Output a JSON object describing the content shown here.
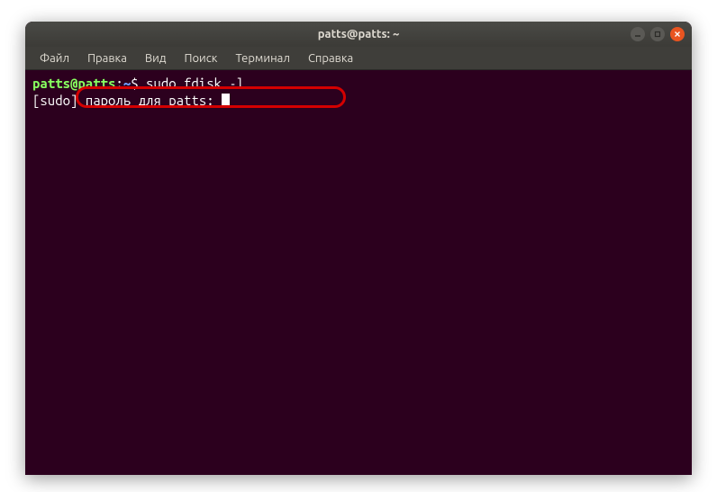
{
  "window": {
    "title": "patts@patts: ~"
  },
  "menubar": {
    "items": [
      {
        "label": "Файл"
      },
      {
        "label": "Правка"
      },
      {
        "label": "Вид"
      },
      {
        "label": "Поиск"
      },
      {
        "label": "Терминал"
      },
      {
        "label": "Справка"
      }
    ]
  },
  "terminal": {
    "prompt": {
      "user_host": "patts@patts",
      "separator": ":",
      "path": "~",
      "dollar": "$"
    },
    "command": "sudo fdisk -l",
    "sudo_prefix": "[sudo] ",
    "sudo_prompt": "пароль для patts: "
  },
  "colors": {
    "terminal_bg": "#2c001e",
    "prompt_green": "#87ff5f",
    "prompt_blue": "#6f9fff",
    "close_button": "#e95420",
    "highlight_red": "#d40000"
  }
}
